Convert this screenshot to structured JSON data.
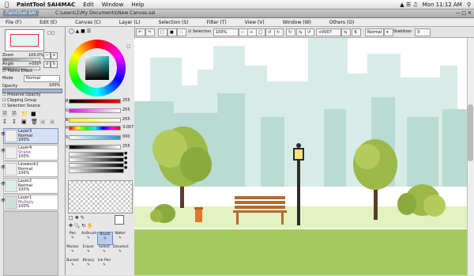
{
  "menubar": {
    "app_name": "PaintTool SAI4MAC",
    "items": [
      "Edit",
      "Window",
      "Help"
    ],
    "clock": "Mon 11:12 AM"
  },
  "titlebar": {
    "logo": "PaintTool SAI",
    "document_path": "C:\\users\\1\\My Documents\\New Canvas.sai"
  },
  "appmenu": {
    "items": [
      "File (F)",
      "Edit (E)",
      "Canvas (C)",
      "Layer (L)",
      "Selection (S)",
      "Filter (T)",
      "View (V)",
      "Window (W)",
      "Others (O)"
    ]
  },
  "toolbar": {
    "selection_label": "Selection",
    "zoom": "100%",
    "rotation": "+0007",
    "blend_mode": "Normal",
    "stabilizer_label": "Stabilizer",
    "stabilizer_value": "3"
  },
  "navigator": {
    "zoom_label": "Zoom",
    "zoom_value": "100.0%",
    "angle_label": "Angle",
    "angle_value": "+000º"
  },
  "layer_panel": {
    "paints_effect_label": "Paints Effect",
    "mode_label": "Mode",
    "mode_value": "Normal",
    "opacity_label": "Opacity",
    "opacity_value": "100%",
    "options": [
      "Preserve Opacity",
      "Clipping Group",
      "Selection Source"
    ],
    "layers": [
      {
        "name": "Layer3",
        "mode": "Normal",
        "opacity": "100%",
        "selected": true
      },
      {
        "name": "Layer4",
        "mode": "Shade",
        "opacity": "100%",
        "selected": false
      },
      {
        "name": "Linework1",
        "mode": "Normal",
        "opacity": "100%",
        "selected": false
      },
      {
        "name": "Layer2",
        "mode": "Normal",
        "opacity": "100%",
        "selected": false
      },
      {
        "name": "Layer1",
        "mode": "Multiply",
        "opacity": "100%",
        "selected": false
      }
    ]
  },
  "color_panel": {
    "rgb": {
      "r_label": "R",
      "r": "255",
      "g_label": "G",
      "g": "255",
      "b_label": "B",
      "b": "255"
    },
    "hsv": {
      "h_label": "H",
      "h": "3:007",
      "s_label": "S",
      "s": "000",
      "v_label": "V",
      "v": "255"
    },
    "accent": "#1ab4b4"
  },
  "tools": {
    "row1": [
      "Pen",
      "AirBrush",
      "Brush",
      "Water"
    ],
    "row2": [
      "Marker",
      "Eraser",
      "Select",
      "Deselect"
    ],
    "row3": [
      "Bucket",
      "Binary",
      "Ink Pen"
    ],
    "selected": "Brush"
  }
}
